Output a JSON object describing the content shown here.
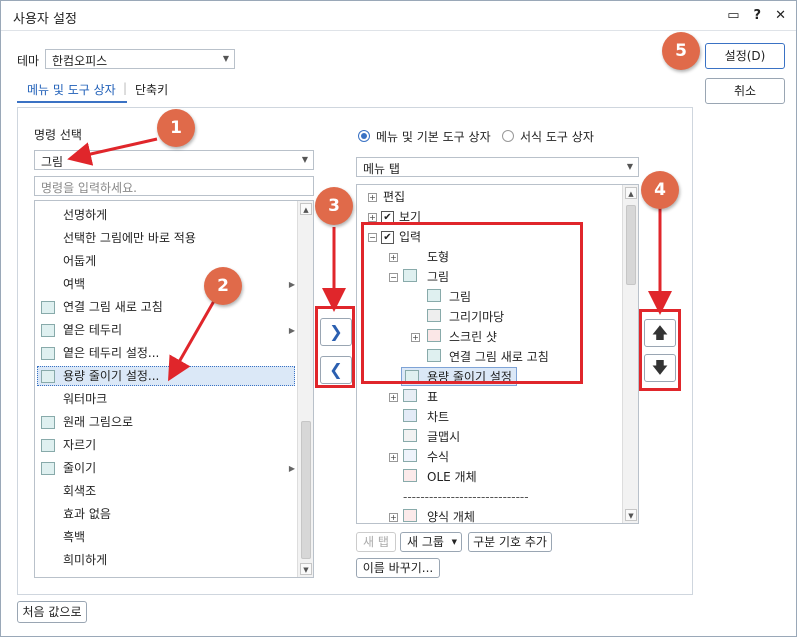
{
  "window": {
    "title": "사용자 설정",
    "icons": [
      "message-icon",
      "help-icon",
      "close-icon"
    ]
  },
  "theme": {
    "label": "테마",
    "value": "한컴오피스"
  },
  "tabs": [
    {
      "label": "메뉴 및 도구 상자"
    },
    {
      "label": "단축키"
    }
  ],
  "buttons": {
    "ok": "설정(D)",
    "cancel": "취소",
    "reset": "처음 값으로",
    "new_tab": "새 탭",
    "new_group": "새 그룹",
    "add_separator": "구분 기호 추가",
    "rename": "이름 바꾸기..."
  },
  "left": {
    "section_label": "명령 선택",
    "category": "그림",
    "search_placeholder": "명령을 입력하세요.",
    "items": [
      {
        "label": "선명하게"
      },
      {
        "label": "선택한 그림에만 바로 적용"
      },
      {
        "label": "어둡게"
      },
      {
        "label": "여백"
      },
      {
        "label": "연결 그림 새로 고침"
      },
      {
        "label": "옅은 테두리"
      },
      {
        "label": "옅은 테두리 설정..."
      },
      {
        "label": "용량 줄이기 설정..."
      },
      {
        "label": "워터마크"
      },
      {
        "label": "원래 그림으로"
      },
      {
        "label": "자르기"
      },
      {
        "label": "줄이기"
      },
      {
        "label": "회색조"
      },
      {
        "label": "효과 없음"
      },
      {
        "label": "흑백"
      },
      {
        "label": "희미하게"
      }
    ]
  },
  "right": {
    "radio1": "메뉴 및 기본 도구 상자",
    "radio2": "서식 도구 상자",
    "dropdown": "메뉴 탭",
    "tree": [
      {
        "label": "편집"
      },
      {
        "label": "보기"
      },
      {
        "label": "입력"
      },
      {
        "label": "도형"
      },
      {
        "label": "그림"
      },
      {
        "label": "그림"
      },
      {
        "label": "그리기마당"
      },
      {
        "label": "스크린 샷"
      },
      {
        "label": "연결 그림 새로 고침"
      },
      {
        "label": "용량 줄이기 설정"
      },
      {
        "label": "표"
      },
      {
        "label": "차트"
      },
      {
        "label": "글맵시"
      },
      {
        "label": "수식"
      },
      {
        "label": "OLE 개체"
      },
      {
        "label": "-----------------------------"
      },
      {
        "label": "양식 개체"
      }
    ]
  },
  "badges": [
    "1",
    "2",
    "3",
    "4",
    "5"
  ],
  "colors": {
    "highlight": "#e0262b",
    "badge": "#e06a4a",
    "selected_bg": "#dbe8f7",
    "accent": "#3a72c4"
  }
}
